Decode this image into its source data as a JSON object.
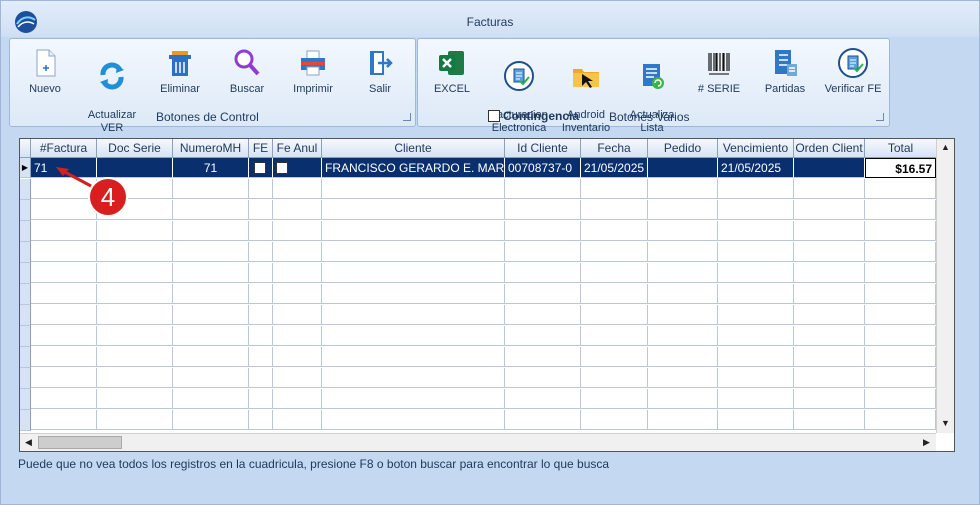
{
  "window": {
    "title": "Facturas"
  },
  "control_group": {
    "label": "Botones de Control",
    "buttons": [
      {
        "label": "Nuevo"
      },
      {
        "label": "Actualizar\nVER"
      },
      {
        "label": "Eliminar"
      },
      {
        "label": "Buscar"
      },
      {
        "label": "Imprimir"
      },
      {
        "label": "Salir"
      }
    ]
  },
  "varios_group": {
    "label": "Botones Varios",
    "contingencia_label": "Contingencia",
    "buttons": [
      {
        "label": "EXCEL"
      },
      {
        "label": "Facturacion\nElectronica"
      },
      {
        "label": "Android\nInventario"
      },
      {
        "label": "Actualiza\nLista"
      },
      {
        "label": "# SERIE"
      },
      {
        "label": "Partidas"
      },
      {
        "label": "Verificar FE"
      }
    ]
  },
  "grid": {
    "columns": [
      "#Factura",
      "Doc Serie",
      "NumeroMH",
      "FE",
      "Fe Anul",
      "Cliente",
      "Id Cliente",
      "Fecha",
      "Pedido",
      "Vencimiento",
      "Orden Client",
      "Total"
    ],
    "rows": [
      {
        "factura": "71",
        "doc_serie": "",
        "numero_mh": "71",
        "cliente": "FRANCISCO GERARDO E. MARMOL",
        "id_cliente": "00708737-0",
        "fecha": "21/05/2025",
        "pedido": "",
        "vencimiento": "21/05/2025",
        "orden": "",
        "total": "$16.57"
      }
    ]
  },
  "annotation": {
    "step": "4",
    "color": "#d81e1e"
  },
  "status_bar": {
    "text": "Puede que no vea todos los registros en la cuadricula, presione F8 o boton buscar para encontrar lo que busca"
  },
  "colors": {
    "selection": "#0a2f6e",
    "accent": "#1e395b"
  }
}
